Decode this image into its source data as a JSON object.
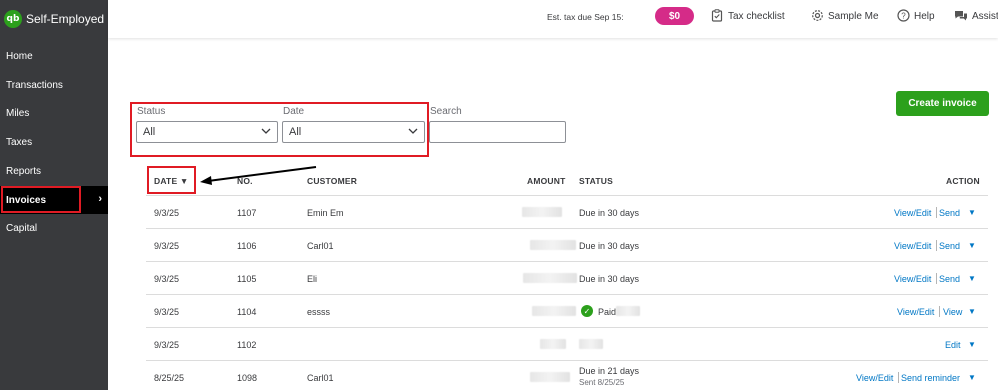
{
  "brand": {
    "logo": "qb",
    "name": "Self-Employed"
  },
  "sidebar": {
    "items": [
      {
        "label": "Home"
      },
      {
        "label": "Transactions"
      },
      {
        "label": "Miles"
      },
      {
        "label": "Taxes"
      },
      {
        "label": "Reports"
      },
      {
        "label": "Invoices",
        "active": true,
        "chevron": "›"
      },
      {
        "label": "Capital"
      }
    ]
  },
  "header": {
    "est_tax_label": "Est. tax due Sep 15:",
    "est_tax_value": "$0",
    "tax_checklist": "Tax checklist",
    "sample_me": "Sample Me",
    "help": "Help",
    "assist": "Assist",
    "icons": [
      "clipboard-icon",
      "gear-icon",
      "help-icon",
      "chat-icon"
    ]
  },
  "toolbar": {
    "create_invoice": "Create invoice"
  },
  "filters": {
    "status_label": "Status",
    "status_value": "All",
    "date_label": "Date",
    "date_value": "All",
    "search_label": "Search",
    "search_value": ""
  },
  "table": {
    "headers": {
      "date": "DATE ▼",
      "no": "NO.",
      "customer": "CUSTOMER",
      "amount": "AMOUNT",
      "status": "STATUS",
      "action": "ACTION"
    },
    "rows": [
      {
        "date": "9/3/25",
        "no": "1107",
        "customer": "Emin Em",
        "status": "Due in 30 days",
        "status_sub": "",
        "action1": "View/Edit",
        "action2": "Send"
      },
      {
        "date": "9/3/25",
        "no": "1106",
        "customer": "Carl01",
        "status": "Due in 30 days",
        "status_sub": "",
        "action1": "View/Edit",
        "action2": "Send"
      },
      {
        "date": "9/3/25",
        "no": "1105",
        "customer": "Eli",
        "status": "Due in 30 days",
        "status_sub": "",
        "action1": "View/Edit",
        "action2": "Send"
      },
      {
        "date": "9/3/25",
        "no": "1104",
        "customer": "essss",
        "status": "Paid",
        "status_sub": "",
        "action1": "View/Edit",
        "action2": "View"
      },
      {
        "date": "9/3/25",
        "no": "1102",
        "customer": "",
        "status": "",
        "status_sub": "",
        "action1": "",
        "action2": "Edit"
      },
      {
        "date": "8/25/25",
        "no": "1098",
        "customer": "Carl01",
        "status": "Due in 21 days",
        "status_sub": "Sent 8/25/25",
        "action1": "View/Edit",
        "action2": "Send reminder"
      }
    ],
    "caret": "▼"
  },
  "colors": {
    "sidebar_bg": "#393a3d",
    "accent_green": "#2ca01c",
    "tax_pill": "#d52b88",
    "link_blue": "#0077c5",
    "highlight_red": "#e01b24"
  }
}
